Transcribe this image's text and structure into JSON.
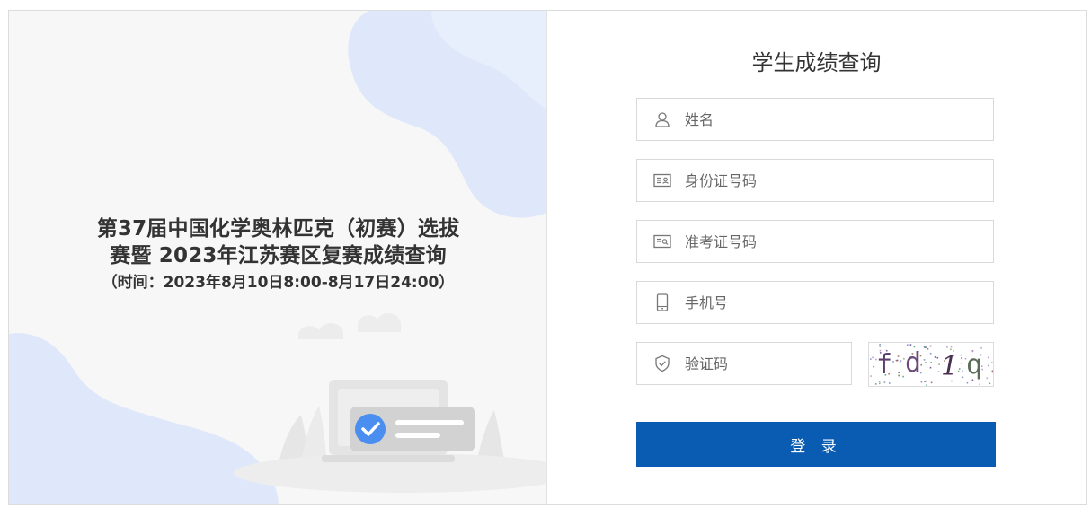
{
  "notice": {
    "line1": "第37届中国化学奥林匹克（初赛）选拔",
    "line2": "赛暨 2023年江苏赛区复赛成绩查询",
    "line3": "（时间：2023年8月10日8:00-8月17日24:00）"
  },
  "form": {
    "title": "学生成绩查询",
    "name_placeholder": "姓名",
    "id_placeholder": "身份证号码",
    "ticket_placeholder": "准考证号码",
    "phone_placeholder": "手机号",
    "captcha_placeholder": "验证码",
    "captcha_text": [
      "f",
      "d",
      "1",
      "q"
    ],
    "submit_label": "登 录"
  },
  "icons": {
    "name": "user-icon",
    "id": "id-card-icon",
    "ticket": "admission-ticket-icon",
    "phone": "mobile-phone-icon",
    "captcha": "shield-check-icon"
  },
  "colors": {
    "primary": "#0a5cb3",
    "decor_blue": "#dfe8fa",
    "check_blue": "#4a8ef0"
  }
}
